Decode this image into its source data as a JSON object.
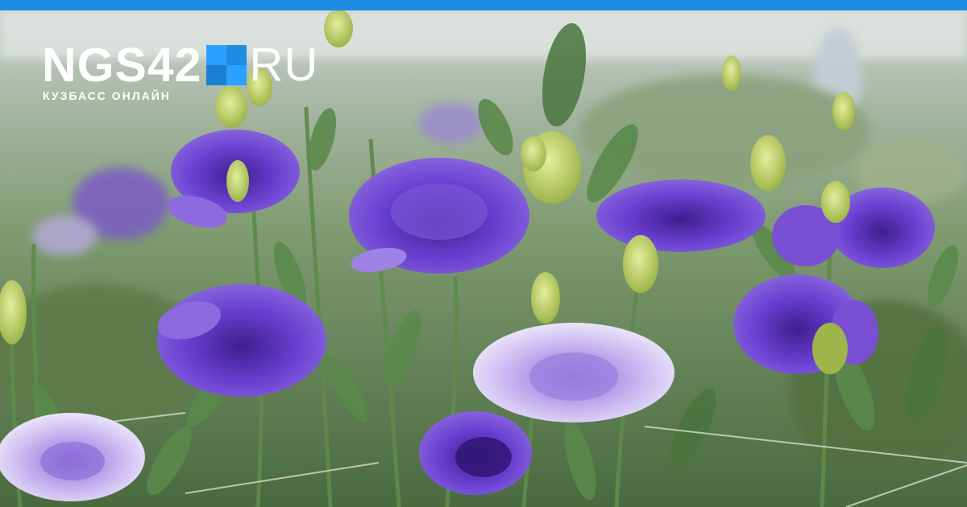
{
  "logo": {
    "prefix": "NGS42",
    "suffix": "RU",
    "tagline": "КУЗБАСС ОНЛАЙН",
    "square_colors": [
      "#2aa1ff",
      "#1e8ce3",
      "#1a7ed2",
      "#2aa1ff"
    ]
  },
  "colors": {
    "accent_bar": "#1e8ce3",
    "flower_purple": "#6a3fd0",
    "flower_light": "#c9b5f2",
    "foliage": "#4f7a45",
    "bud": "#c9d96a"
  },
  "photo": {
    "subject": "purple lisianthus flowers in a greenhouse"
  }
}
